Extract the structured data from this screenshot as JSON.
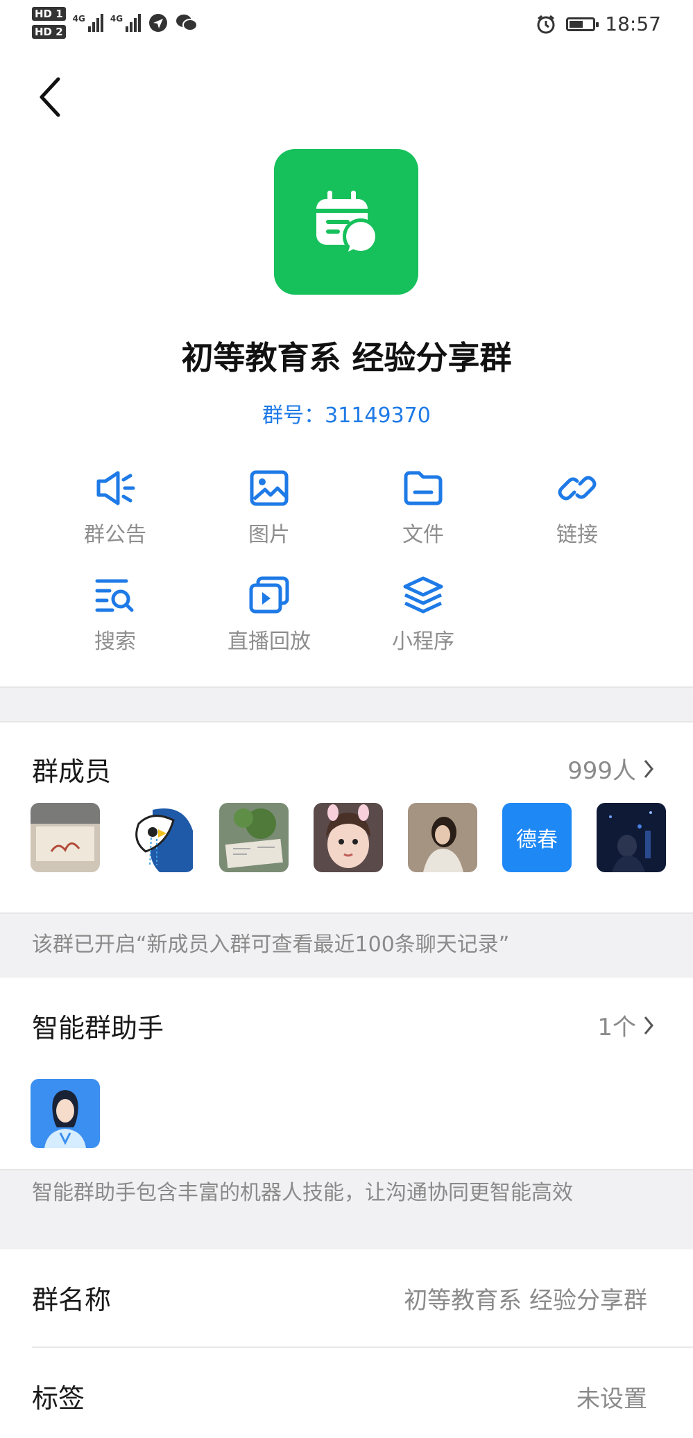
{
  "status_bar": {
    "sim1": "HD 1",
    "sim2": "HD 2",
    "net1": "4G",
    "net2": "4G",
    "time": "18:57",
    "battery_level": 0.6,
    "icons": [
      "signal-icon",
      "location-icon",
      "wechat-icon",
      "alarm-icon",
      "battery-icon"
    ]
  },
  "group": {
    "name": "初等教育系 经验分享群",
    "id_text": "群号：31149370",
    "icon_color": "#16c05b"
  },
  "quick_actions": [
    {
      "label": "群公告",
      "icon": "announcement-icon"
    },
    {
      "label": "图片",
      "icon": "image-icon"
    },
    {
      "label": "文件",
      "icon": "folder-icon"
    },
    {
      "label": "链接",
      "icon": "link-icon"
    },
    {
      "label": "搜索",
      "icon": "search-list-icon"
    },
    {
      "label": "直播回放",
      "icon": "replay-icon"
    },
    {
      "label": "小程序",
      "icon": "layers-icon"
    }
  ],
  "members": {
    "title": "群成员",
    "count": "999人",
    "avatars": [
      "avatar-photo-1",
      "avatar-bird",
      "avatar-plant",
      "avatar-child",
      "avatar-girl",
      "德春",
      "avatar-night"
    ],
    "notice": "该群已开启“新成员入群可查看最近100条聊天记录”"
  },
  "assistant": {
    "title": "智能群助手",
    "count": "1个",
    "description": "智能群助手包含丰富的机器人技能，让沟通协同更智能高效"
  },
  "settings": [
    {
      "label": "群名称",
      "value": "初等教育系 经验分享群"
    },
    {
      "label": "标签",
      "value": "未设置"
    }
  ],
  "colors": {
    "accent": "#1e7ae6",
    "brand_green": "#16c05b",
    "badge_blue": "#1e88f5"
  }
}
